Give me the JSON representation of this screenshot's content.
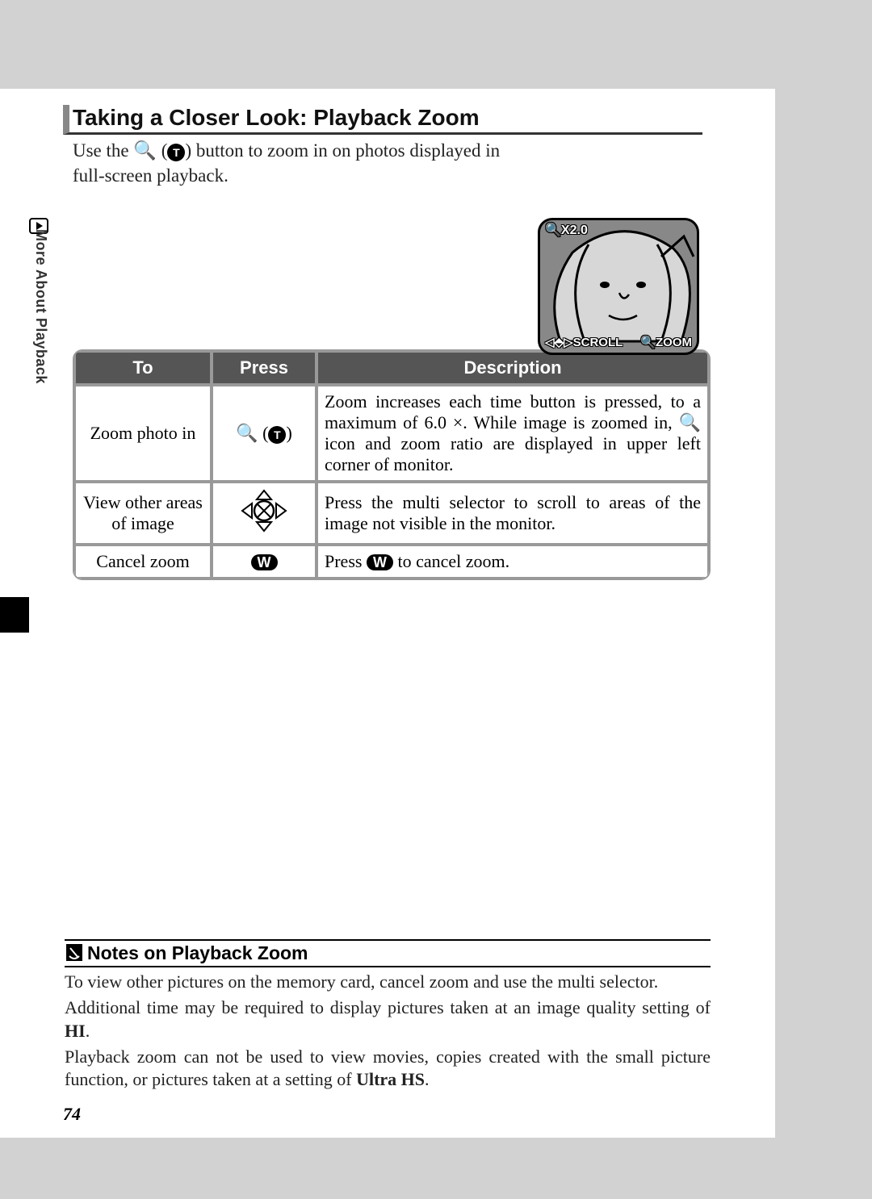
{
  "side_tab": "More About Playback",
  "section_title": "Taking a Closer Look: Playback Zoom",
  "intro_pre": "Use the ",
  "intro_post": " button to zoom in on photos displayed in full-screen playback.",
  "illustration": {
    "zoom_label": "X2.0",
    "scroll_label": "SCROLL",
    "zoom_hint": "ZOOM"
  },
  "table": {
    "headers": {
      "to": "To",
      "press": "Press",
      "desc": "Description"
    },
    "rows": [
      {
        "to": "Zoom photo in",
        "press_type": "zoom-in",
        "desc_pre": "Zoom increases each time button is pressed, to a maximum of 6.0 ×.  While image is zoomed in, ",
        "desc_post": " icon and zoom ratio are displayed in upper left corner of monitor."
      },
      {
        "to": "View other areas of image",
        "press_type": "multi-selector",
        "desc": "Press the multi selector to scroll to areas of the image not visible in the monitor."
      },
      {
        "to": "Cancel zoom",
        "press_type": "w-button",
        "desc_pre": "Press ",
        "desc_post": " to cancel zoom."
      }
    ]
  },
  "notes": {
    "title": "Notes on Playback Zoom",
    "p1": "To view other pictures on the memory card, cancel zoom and use the multi selector.",
    "p2_pre": "Additional time may be required to display pictures taken at an image quality setting of ",
    "p2_bold": "HI",
    "p2_post": ".",
    "p3_pre": "Playback zoom can not be used to view movies, copies created with the small picture function, or pictures taken at a setting of ",
    "p3_bold": "Ultra HS",
    "p3_post": "."
  },
  "page_number": "74"
}
